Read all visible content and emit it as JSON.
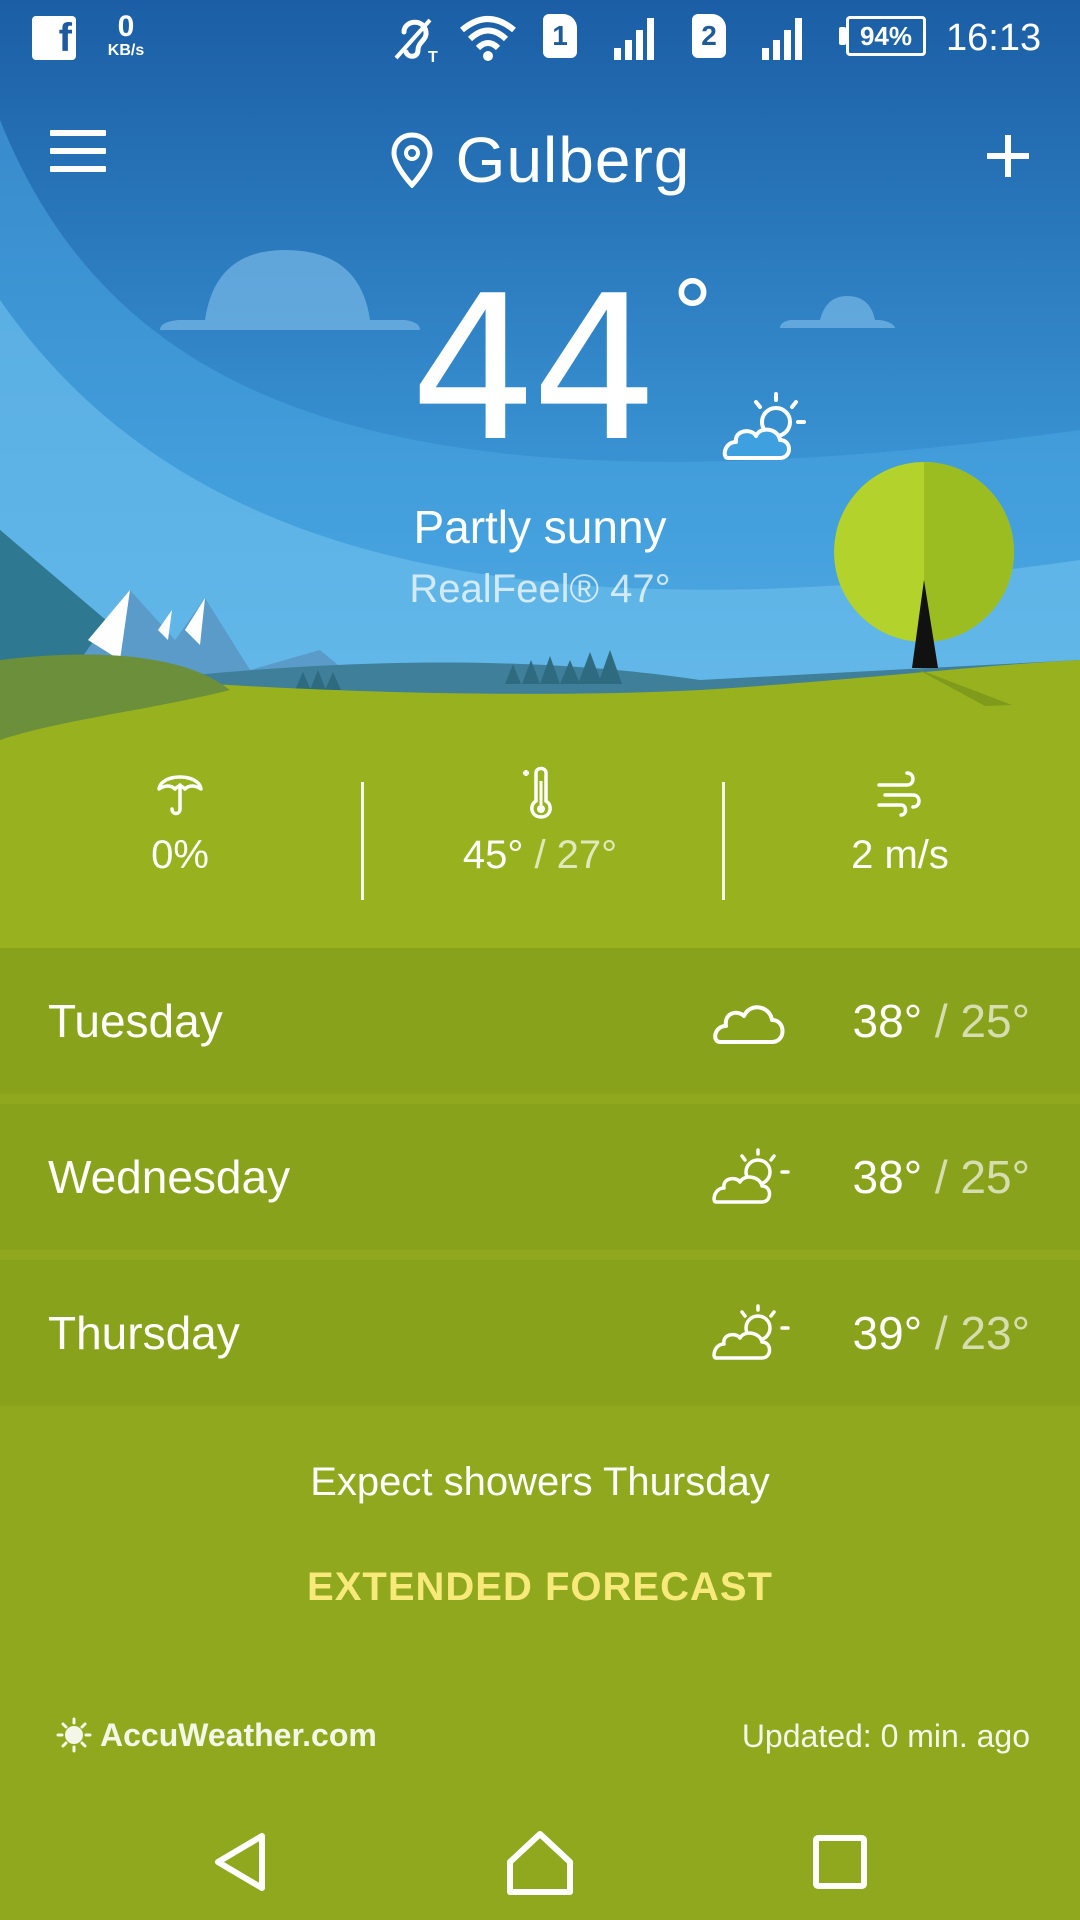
{
  "status_bar": {
    "net_speed_value": "0",
    "net_speed_unit": "KB/s",
    "sim1": "1",
    "sim2": "2",
    "battery": "94%",
    "time": "16:13",
    "icons": [
      "facebook-icon",
      "hearing-aid-icon",
      "wifi-icon",
      "signal-icon",
      "battery-icon"
    ]
  },
  "header": {
    "location": "Gulberg",
    "menu_icon": "hamburger-menu-icon",
    "add_icon": "plus-icon"
  },
  "current": {
    "temperature": "44",
    "degree_symbol": "°",
    "condition": "Partly sunny",
    "realfeel": "RealFeel® 47°",
    "icon": "partly-sunny-icon"
  },
  "stats": {
    "precipitation": "0%",
    "high": "45°",
    "low": "/ 27°",
    "wind": "2 m/s"
  },
  "forecast": [
    {
      "day": "Tuesday",
      "icon": "cloud-icon",
      "high": "38°",
      "low": "/ 25°"
    },
    {
      "day": "Wednesday",
      "icon": "partly-sunny-icon",
      "high": "38°",
      "low": "/ 25°"
    },
    {
      "day": "Thursday",
      "icon": "partly-sunny-icon",
      "high": "39°",
      "low": "/ 23°"
    }
  ],
  "summary": "Expect showers Thursday",
  "extended_forecast": "EXTENDED FORECAST",
  "brand": "AccuWeather.com",
  "updated": "Updated: 0 min. ago",
  "colors": {
    "sky_top": "#1b5ea6",
    "sky_bottom": "#6ec3ee",
    "grass": "#8fa81e",
    "accent_yellow": "#f7e97a"
  }
}
